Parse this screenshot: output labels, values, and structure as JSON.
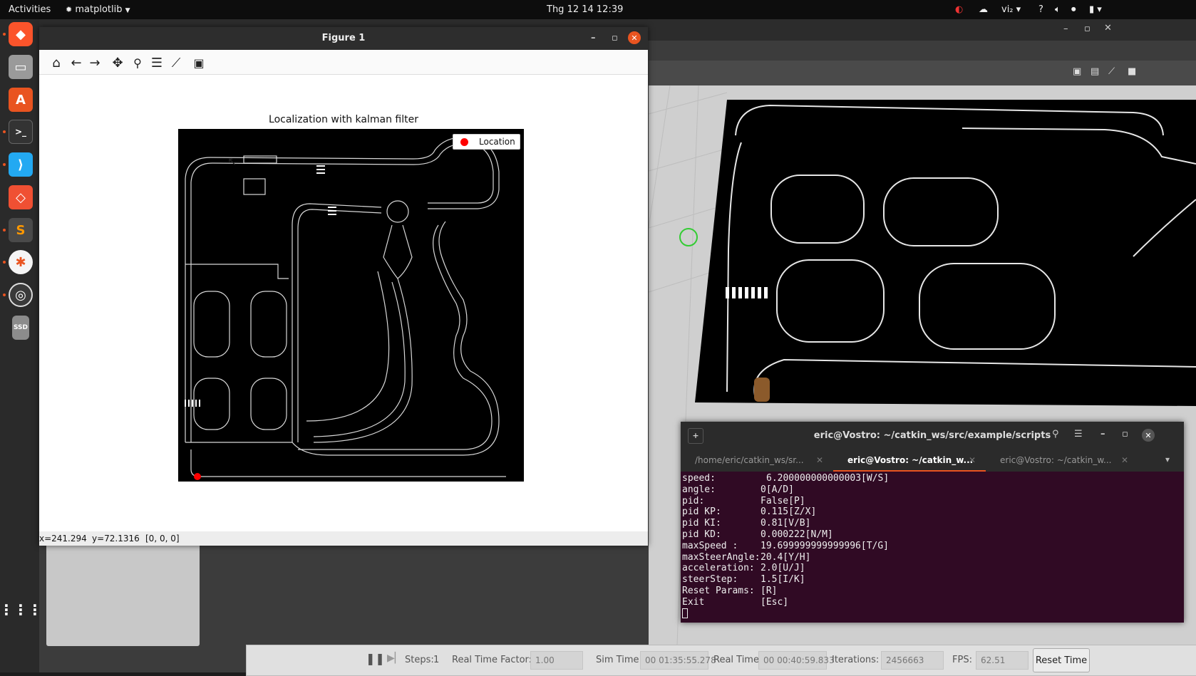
{
  "topbar": {
    "activities": "Activities",
    "app_menu": "matplotlib",
    "clock": "Thg 12 14  12:39",
    "input_method": "vi₂"
  },
  "dock": {
    "items": [
      "brave-browser",
      "files",
      "app-center",
      "terminal",
      "vscode",
      "git-app",
      "sublime-text",
      "gazebo",
      "obs-studio",
      "ssd-drive"
    ],
    "show_apps": "show-applications"
  },
  "figure": {
    "title": "Figure 1",
    "toolbar": [
      "home",
      "back",
      "forward",
      "pan",
      "zoom",
      "configure-subplots",
      "edit-axis",
      "save"
    ],
    "plot_title": "Localization with kalman filter",
    "legend_label": "Location",
    "location_color": "#ff0000",
    "status": {
      "x": "x=241.294",
      "y": "y=72.1316",
      "value": "[0, 0, 0]"
    }
  },
  "terminal": {
    "title": "eric@Vostro: ~/catkin_ws/src/example/scripts",
    "tabs": [
      {
        "label": "/home/eric/catkin_ws/sr...",
        "active": false
      },
      {
        "label": "eric@Vostro: ~/catkin_w...",
        "active": true
      },
      {
        "label": "eric@Vostro: ~/catkin_w...",
        "active": false
      }
    ],
    "lines": [
      {
        "key": "speed:",
        "value": "6.200000000000003[W/S]"
      },
      {
        "key": "angle:",
        "value": "0[A/D]"
      },
      {
        "key": "pid:",
        "value": "False[P]"
      },
      {
        "key": "pid KP:",
        "value": "0.115[Z/X]"
      },
      {
        "key": "pid KI:",
        "value": "0.81[V/B]"
      },
      {
        "key": "pid KD:",
        "value": "0.000222[N/M]"
      },
      {
        "key": "maxSpeed :",
        "value": "19.699999999999996[T/G]"
      },
      {
        "key": "maxSteerAngle:",
        "value": "20.4[Y/H]"
      },
      {
        "key": "acceleration:",
        "value": "2.0[U/J]"
      },
      {
        "key": "steerStep:",
        "value": "1.5[I/K]"
      },
      {
        "key": "Reset Params:",
        "value": "[R]"
      },
      {
        "key": "Exit",
        "value": "[Esc]"
      }
    ]
  },
  "gazebo": {
    "bottom": {
      "steps_label": "Steps:",
      "steps_value": "1",
      "rtf_label": "Real Time Factor:",
      "rtf_value": "1.00",
      "sim_label": "Sim Time:",
      "sim_value": "00 01:35:55.278",
      "real_label": "Real Time:",
      "real_value": "00 00:40:59.833",
      "iter_label": "Iterations:",
      "iter_value": "2456663",
      "fps_label": "FPS:",
      "fps_value": "62.51",
      "reset_label": "Reset Time"
    }
  }
}
